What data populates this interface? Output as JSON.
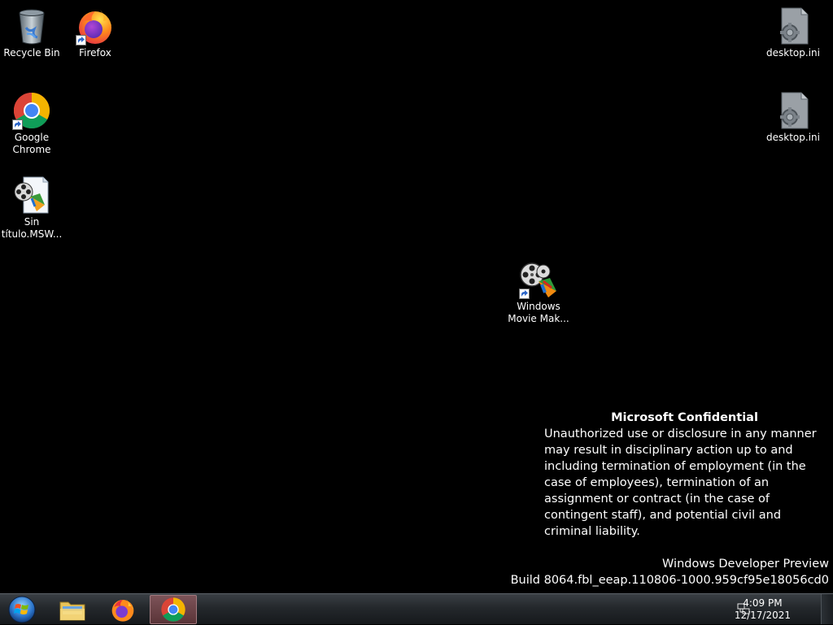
{
  "desktop": {
    "icons": [
      {
        "label": "Recycle Bin",
        "icon": "recycle-bin-icon"
      },
      {
        "label": "Firefox",
        "icon": "firefox-icon"
      },
      {
        "label": "Google Chrome",
        "icon": "chrome-icon"
      },
      {
        "label": "Sin título.MSW...",
        "icon": "movie-project-icon"
      },
      {
        "label": "Windows Movie Mak...",
        "icon": "movie-maker-icon"
      },
      {
        "label": "desktop.ini",
        "icon": "settings-file-icon"
      },
      {
        "label": "desktop.ini",
        "icon": "settings-file-icon"
      }
    ]
  },
  "watermark": {
    "title": "Microsoft Confidential",
    "body": "Unauthorized use or disclosure in any manner may result in disciplinary action up to and including termination of employment (in the case of employees), termination of an assignment or contract (in the case of contingent staff), and potential civil and criminal liability.",
    "edition": "Windows Developer Preview",
    "build": "Build 8064.fbl_eeap.110806-1000.959cf95e18056cd0"
  },
  "taskbar": {
    "pinned": [
      {
        "name": "Windows Explorer",
        "icon": "folder-icon"
      },
      {
        "name": "Firefox",
        "icon": "firefox-icon"
      },
      {
        "name": "Google Chrome",
        "icon": "chrome-icon",
        "active": true
      }
    ],
    "clock": {
      "time": "4:09 PM",
      "date": "12/17/2021"
    }
  },
  "colors": {
    "desktop_bg": "#000000",
    "taskbar_bg": "#24282c",
    "active_button": "#6b4347"
  }
}
